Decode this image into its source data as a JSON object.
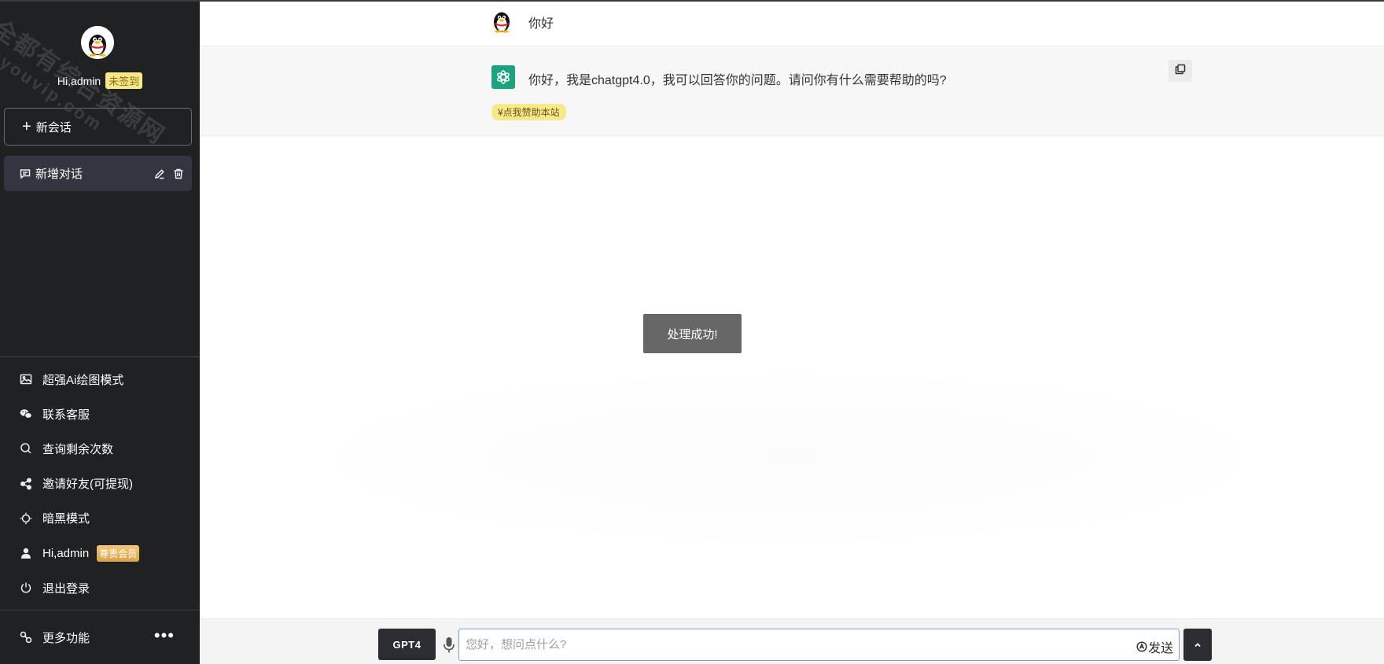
{
  "sidebar": {
    "watermark": {
      "line1": "全都有综合资源网",
      "line2": "douyouvip.com"
    },
    "user": {
      "greeting": "Hi,admin",
      "checkin_badge": "未签到"
    },
    "new_chat_label": "新会话",
    "conversations": [
      {
        "label": "新增对话"
      }
    ],
    "menu": [
      {
        "icon": "image-icon",
        "label": "超强Ai绘图模式"
      },
      {
        "icon": "wechat-icon",
        "label": "联系客服"
      },
      {
        "icon": "search-icon",
        "label": "查询剩余次数"
      },
      {
        "icon": "share-icon",
        "label": "邀请好友(可提现)"
      },
      {
        "icon": "dark-mode-icon",
        "label": "暗黑模式"
      },
      {
        "icon": "user-icon",
        "label": "Hi,admin",
        "badge": "尊贵会员"
      },
      {
        "icon": "power-icon",
        "label": "退出登录"
      }
    ],
    "more_label": "更多功能"
  },
  "chat": {
    "user_message": "你好",
    "bot_message": "你好，我是chatgpt4.0，我可以回答你的问题。请问你有什么需要帮助的吗?",
    "donate_label": "¥点我赞助本站"
  },
  "toast": "处理成功!",
  "composer": {
    "model_label": "GPT4",
    "placeholder": "您好，想问点什么?",
    "value": "",
    "send_label": "发送"
  },
  "colors": {
    "sidebar_bg": "#202123",
    "active_item_bg": "#343541",
    "bot_bg": "#f7f7f8",
    "openai_green": "#19a37f",
    "badge_yellow": "#f7e98a",
    "vip_gold": "#d9a24a"
  }
}
